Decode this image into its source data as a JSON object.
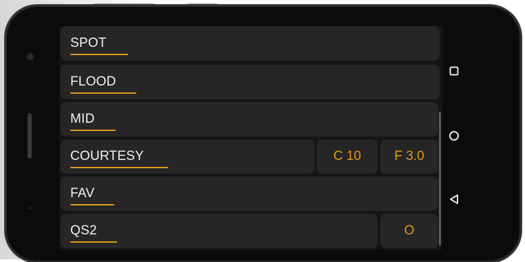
{
  "rows": [
    {
      "label": "SPOT"
    },
    {
      "label": "FLOOD"
    },
    {
      "label": "MID"
    },
    {
      "label": "COURTESY",
      "values": [
        "C 10",
        "F 3.0"
      ]
    },
    {
      "label": "FAV"
    },
    {
      "label": "QS2",
      "values": [
        "O"
      ]
    }
  ],
  "nav": {
    "recents_icon": "square-icon",
    "home_icon": "circle-icon",
    "back_icon": "triangle-back-icon"
  },
  "colors": {
    "accent": "#e09a1e",
    "cell": "#262626",
    "screen": "#151515",
    "text": "#f2f2f2"
  }
}
